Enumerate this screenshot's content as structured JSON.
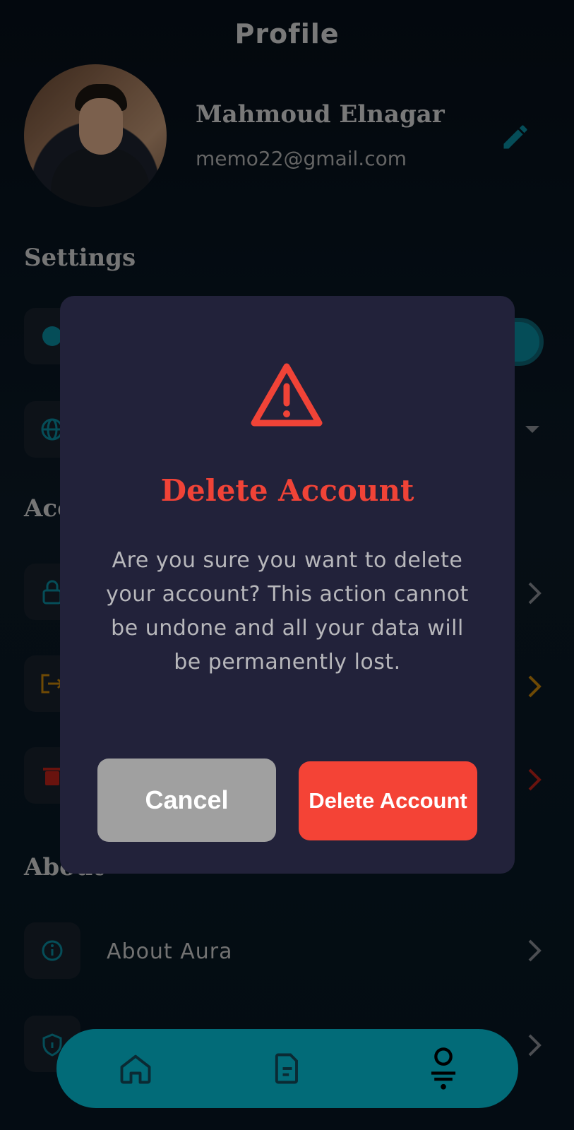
{
  "header": {
    "title": "Profile"
  },
  "profile": {
    "name": "Mahmoud Elnagar",
    "email": "memo22@gmail.com"
  },
  "sections": {
    "settings": "Settings",
    "account": "Acc",
    "about": "About"
  },
  "about_items": [
    {
      "label": "About Aura",
      "icon": "info-icon"
    },
    {
      "label": "",
      "icon": "shield-icon"
    }
  ],
  "dialog": {
    "title": "Delete Account",
    "message": "Are you sure you want to delete your account? This action cannot be undone and all your data will be permanently lost.",
    "cancel_label": "Cancel",
    "confirm_label": "Delete Account",
    "icon": "warning-icon"
  },
  "bottom_nav": {
    "items": [
      {
        "icon": "home-icon"
      },
      {
        "icon": "document-icon"
      },
      {
        "icon": "profile-icon",
        "active": true
      }
    ]
  },
  "colors": {
    "accent": "#0a8ca0",
    "danger": "#f44336",
    "dialog_bg": "#22223a",
    "nav_bg": "#026b78"
  }
}
